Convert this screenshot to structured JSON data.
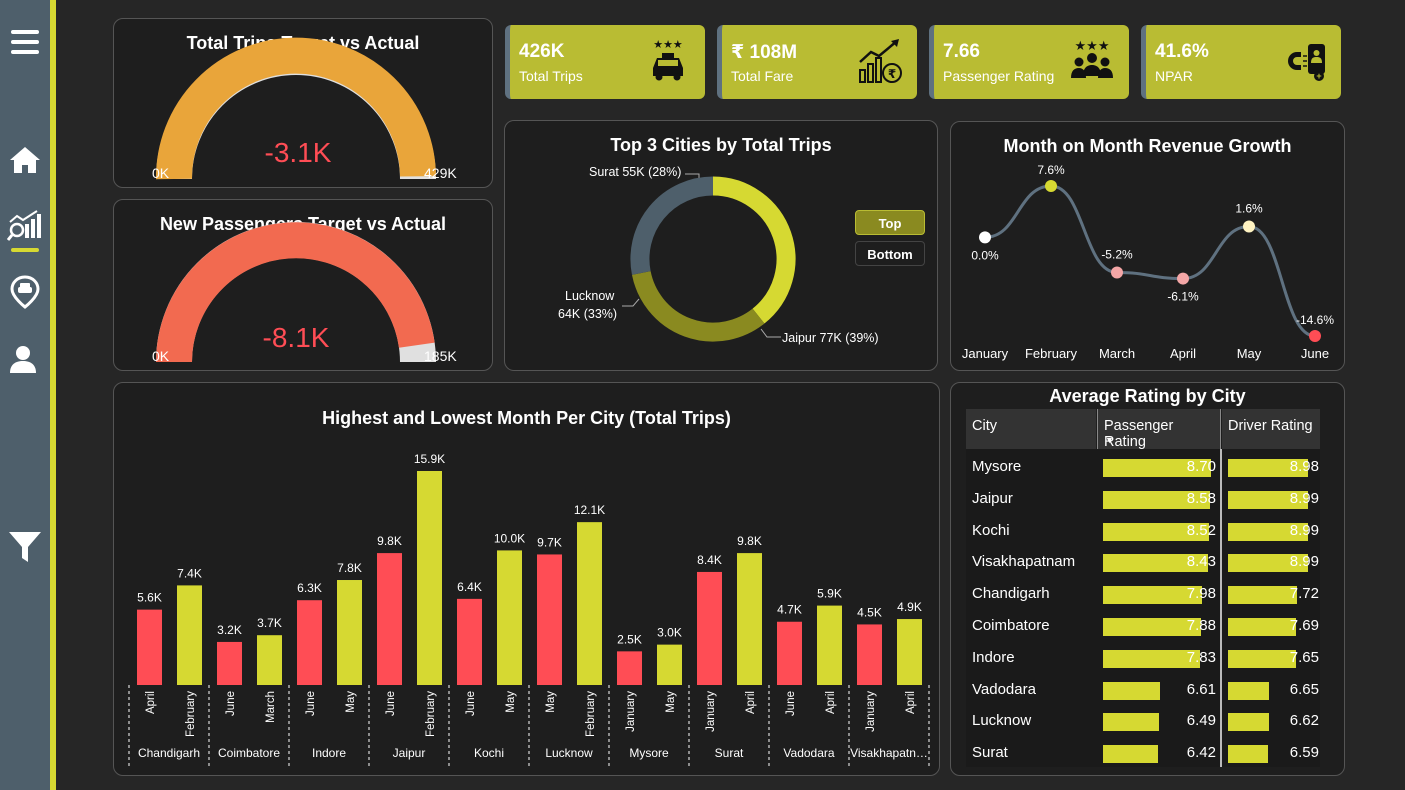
{
  "sidebar": {
    "items": [
      {
        "name": "menu-icon"
      },
      {
        "name": "home-icon"
      },
      {
        "name": "analytics-icon"
      },
      {
        "name": "location-icon"
      },
      {
        "name": "user-icon"
      },
      {
        "name": "filter-icon"
      }
    ],
    "accent": "#d6d932"
  },
  "gauges": [
    {
      "title": "Total Trips Target vs Actual",
      "value": "-3.1K",
      "min": "0K",
      "max": "429K",
      "color": "#e9a53a",
      "fraction": 0.993
    },
    {
      "title": "New Passengers Target vs Actual",
      "value": "-8.1K",
      "min": "0K",
      "max": "185K",
      "color": "#f26a50",
      "fraction": 0.956
    }
  ],
  "kpis": [
    {
      "value": "426K",
      "label": "Total Trips",
      "icon": "taxi-icon"
    },
    {
      "value": "₹ 108M",
      "label": "Total Fare",
      "icon": "revenue-growth-icon"
    },
    {
      "value": "7.66",
      "label": "Passenger Rating",
      "icon": "group-rating-icon"
    },
    {
      "value": "41.6%",
      "label": "NPAR",
      "icon": "passenger-retention-icon"
    }
  ],
  "donut": {
    "title": "Top 3 Cities by Total Trips",
    "buttons": {
      "top": "Top",
      "bottom": "Bottom"
    },
    "labels": {
      "surat": "Surat 55K (28%)",
      "lucknow_line1": "Lucknow",
      "lucknow_line2": "64K (33%)",
      "jaipur": "Jaipur 77K (39%)"
    }
  },
  "revenue": {
    "title": "Month on Month Revenue Growth"
  },
  "bars": {
    "title": "Highest and Lowest Month Per City (Total Trips)"
  },
  "ratings": {
    "title": "Average Rating by City",
    "headers": [
      "City",
      "Passenger Rating",
      "Driver Rating"
    ],
    "rows": [
      {
        "city": "Mysore",
        "passenger": "8.70",
        "driver": "8.98"
      },
      {
        "city": "Jaipur",
        "passenger": "8.58",
        "driver": "8.99"
      },
      {
        "city": "Kochi",
        "passenger": "8.52",
        "driver": "8.99"
      },
      {
        "city": "Visakhapatnam",
        "passenger": "8.43",
        "driver": "8.99"
      },
      {
        "city": "Chandigarh",
        "passenger": "7.98",
        "driver": "7.72"
      },
      {
        "city": "Coimbatore",
        "passenger": "7.88",
        "driver": "7.69"
      },
      {
        "city": "Indore",
        "passenger": "7.83",
        "driver": "7.65"
      },
      {
        "city": "Vadodara",
        "passenger": "6.61",
        "driver": "6.65"
      },
      {
        "city": "Lucknow",
        "passenger": "6.49",
        "driver": "6.62"
      },
      {
        "city": "Surat",
        "passenger": "6.42",
        "driver": "6.59"
      }
    ]
  },
  "chart_data": [
    {
      "type": "pie",
      "title": "Top 3 Cities by Total Trips",
      "categories": [
        "Jaipur",
        "Lucknow",
        "Surat"
      ],
      "values": [
        77,
        64,
        55
      ],
      "percent": [
        39,
        33,
        28
      ],
      "colors": [
        "#d6d932",
        "#8a8a20",
        "#4e5f6b"
      ]
    },
    {
      "type": "line",
      "title": "Month on Month Revenue Growth",
      "categories": [
        "January",
        "February",
        "March",
        "April",
        "May",
        "June"
      ],
      "values": [
        0.0,
        7.6,
        -5.2,
        -6.1,
        1.6,
        -14.6
      ],
      "labels": [
        "0.0%",
        "7.6%",
        "-5.2%",
        "-6.1%",
        "1.6%",
        "-14.6%"
      ],
      "point_colors": [
        "#ffffff",
        "#d6d932",
        "#f4a6a6",
        "#f4a6a6",
        "#fff3c2",
        "#ff4d55"
      ]
    },
    {
      "type": "bar",
      "title": "Highest and Lowest Month Per City (Total Trips)",
      "ylim": [
        0,
        15.9
      ],
      "groups": [
        {
          "city": "Chandigarh",
          "bars": [
            {
              "month": "April",
              "value": 5.6,
              "label": "5.6K",
              "kind": "low"
            },
            {
              "month": "February",
              "value": 7.4,
              "label": "7.4K",
              "kind": "high"
            }
          ]
        },
        {
          "city": "Coimbatore",
          "bars": [
            {
              "month": "June",
              "value": 3.2,
              "label": "3.2K",
              "kind": "low"
            },
            {
              "month": "March",
              "value": 3.7,
              "label": "3.7K",
              "kind": "high"
            }
          ]
        },
        {
          "city": "Indore",
          "bars": [
            {
              "month": "June",
              "value": 6.3,
              "label": "6.3K",
              "kind": "low"
            },
            {
              "month": "May",
              "value": 7.8,
              "label": "7.8K",
              "kind": "high"
            }
          ]
        },
        {
          "city": "Jaipur",
          "bars": [
            {
              "month": "June",
              "value": 9.8,
              "label": "9.8K",
              "kind": "low"
            },
            {
              "month": "February",
              "value": 15.9,
              "label": "15.9K",
              "kind": "high"
            }
          ]
        },
        {
          "city": "Kochi",
          "bars": [
            {
              "month": "June",
              "value": 6.4,
              "label": "6.4K",
              "kind": "low"
            },
            {
              "month": "May",
              "value": 10.0,
              "label": "10.0K",
              "kind": "high"
            }
          ]
        },
        {
          "city": "Lucknow",
          "bars": [
            {
              "month": "May",
              "value": 9.7,
              "label": "9.7K",
              "kind": "low"
            },
            {
              "month": "February",
              "value": 12.1,
              "label": "12.1K",
              "kind": "high"
            }
          ]
        },
        {
          "city": "Mysore",
          "bars": [
            {
              "month": "January",
              "value": 2.5,
              "label": "2.5K",
              "kind": "low"
            },
            {
              "month": "May",
              "value": 3.0,
              "label": "3.0K",
              "kind": "high"
            }
          ]
        },
        {
          "city": "Surat",
          "bars": [
            {
              "month": "January",
              "value": 8.4,
              "label": "8.4K",
              "kind": "low"
            },
            {
              "month": "April",
              "value": 9.8,
              "label": "9.8K",
              "kind": "high"
            }
          ]
        },
        {
          "city": "Vadodara",
          "bars": [
            {
              "month": "June",
              "value": 4.7,
              "label": "4.7K",
              "kind": "low"
            },
            {
              "month": "April",
              "value": 5.9,
              "label": "5.9K",
              "kind": "high"
            }
          ]
        },
        {
          "city": "Visakhapatn…",
          "bars": [
            {
              "month": "January",
              "value": 4.5,
              "label": "4.5K",
              "kind": "low"
            },
            {
              "month": "April",
              "value": 4.9,
              "label": "4.9K",
              "kind": "high"
            }
          ]
        }
      ],
      "colors": {
        "low": "#ff4d55",
        "high": "#d6d932"
      }
    },
    {
      "type": "table",
      "title": "Average Rating by City",
      "columns": [
        "City",
        "Passenger Rating",
        "Driver Rating"
      ],
      "passenger": [
        8.7,
        8.58,
        8.52,
        8.43,
        7.98,
        7.88,
        7.83,
        6.61,
        6.49,
        6.42
      ],
      "driver": [
        8.98,
        8.99,
        8.99,
        8.99,
        7.72,
        7.69,
        7.65,
        6.65,
        6.62,
        6.59
      ]
    }
  ]
}
